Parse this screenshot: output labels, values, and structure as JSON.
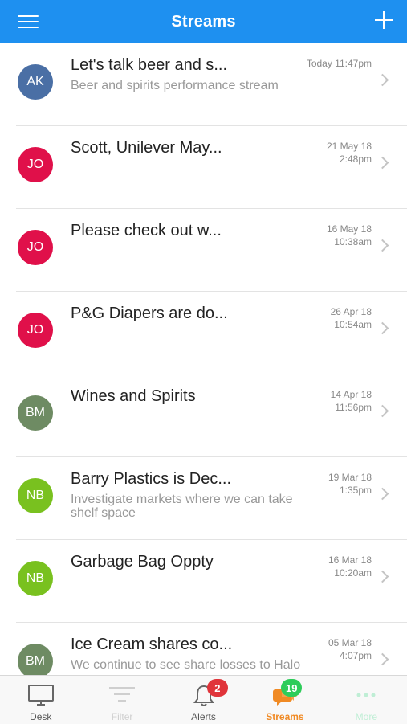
{
  "header": {
    "title": "Streams"
  },
  "streams": [
    {
      "initials": "AK",
      "color": "#4a6fa5",
      "title": "Let's talk beer and s...",
      "subtitle": "Beer and spirits performance stream",
      "date": "Today 11:47pm",
      "time": ""
    },
    {
      "initials": "JO",
      "color": "#e0104a",
      "title": "Scott, Unilever May...",
      "subtitle": "",
      "date": "21 May 18",
      "time": "2:48pm"
    },
    {
      "initials": "JO",
      "color": "#e0104a",
      "title": "Please check out w...",
      "subtitle": "",
      "date": "16 May 18",
      "time": "10:38am"
    },
    {
      "initials": "JO",
      "color": "#e0104a",
      "title": "P&G Diapers are do...",
      "subtitle": "",
      "date": "26 Apr 18",
      "time": "10:54am"
    },
    {
      "initials": "BM",
      "color": "#6e8b63",
      "title": "Wines and Spirits",
      "subtitle": "",
      "date": "14 Apr 18",
      "time": "11:56pm"
    },
    {
      "initials": "NB",
      "color": "#79c11f",
      "title": "Barry Plastics is Dec...",
      "subtitle": "Investigate markets where we can take shelf space",
      "date": "19 Mar 18",
      "time": "1:35pm"
    },
    {
      "initials": "NB",
      "color": "#79c11f",
      "title": "Garbage Bag Oppty",
      "subtitle": "",
      "date": "16 Mar 18",
      "time": "10:20am"
    },
    {
      "initials": "BM",
      "color": "#6e8b63",
      "title": "Ice Cream shares co...",
      "subtitle": "We continue to see share losses to Halo",
      "date": "05 Mar 18",
      "time": "4:07pm"
    }
  ],
  "tabs": {
    "desk": {
      "label": "Desk"
    },
    "filter": {
      "label": "Filter"
    },
    "alerts": {
      "label": "Alerts",
      "badge": "2",
      "badge_color": "#e0343a"
    },
    "streams": {
      "label": "Streams",
      "badge": "19",
      "badge_color": "#2ecc5a"
    },
    "more": {
      "label": "More"
    }
  },
  "colors": {
    "accent": "#1e90f0",
    "active_tab": "#f08a24"
  },
  "icons": {
    "menu": "hamburger-menu-icon",
    "add": "plus-icon",
    "row": "chevron-right-icon"
  }
}
